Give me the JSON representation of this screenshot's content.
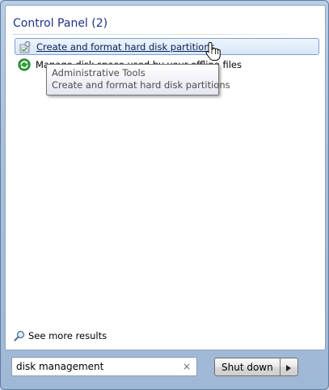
{
  "results": {
    "group_header": "Control Panel (2)",
    "items": [
      {
        "label": "Create and format hard disk partitions",
        "icon": "admin-tools-icon"
      },
      {
        "label": "Manage disk space used by your offline files",
        "icon": "sync-center-icon"
      }
    ],
    "tooltip": {
      "line1": "Administrative Tools",
      "line2": "Create and format hard disk partitions"
    },
    "see_more": "See more results"
  },
  "search": {
    "value": "disk management",
    "clear_icon": "×"
  },
  "power": {
    "shutdown_label": "Shut down",
    "arrow_icon": "chevron-right-icon"
  },
  "colors": {
    "header_text": "#1e3287",
    "selection_border": "#7da2ce",
    "frame": "#a9c0da"
  }
}
